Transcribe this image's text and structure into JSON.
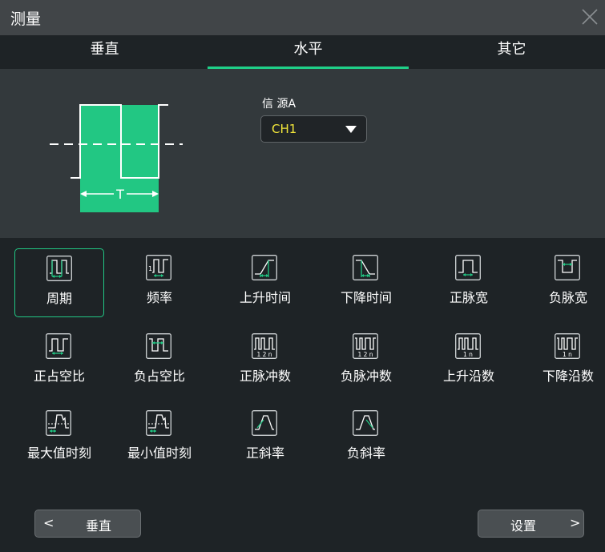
{
  "window": {
    "title": "测量"
  },
  "tabs": [
    {
      "label": "垂直",
      "active": false
    },
    {
      "label": "水平",
      "active": true
    },
    {
      "label": "其它",
      "active": false
    }
  ],
  "diagram": {
    "period_label": "T"
  },
  "source": {
    "label": "信 源A",
    "value": "CH1"
  },
  "items": [
    {
      "label": "周期",
      "icon": "period-icon",
      "selected": true
    },
    {
      "label": "频率",
      "icon": "frequency-icon"
    },
    {
      "label": "上升时间",
      "icon": "rise-time-icon"
    },
    {
      "label": "下降时间",
      "icon": "fall-time-icon"
    },
    {
      "label": "正脉宽",
      "icon": "positive-width-icon"
    },
    {
      "label": "负脉宽",
      "icon": "negative-width-icon"
    },
    {
      "label": "正占空比",
      "icon": "positive-duty-icon"
    },
    {
      "label": "负占空比",
      "icon": "negative-duty-icon"
    },
    {
      "label": "正脉冲数",
      "icon": "positive-pulse-count-icon",
      "icon_text": "1 2  n"
    },
    {
      "label": "负脉冲数",
      "icon": "negative-pulse-count-icon",
      "icon_text": "1 2  n"
    },
    {
      "label": "上升沿数",
      "icon": "rising-edge-count-icon",
      "icon_text": "1   n"
    },
    {
      "label": "下降沿数",
      "icon": "falling-edge-count-icon",
      "icon_text": "1   n"
    },
    {
      "label": "最大值时刻",
      "icon": "time-of-max-icon"
    },
    {
      "label": "最小值时刻",
      "icon": "time-of-min-icon"
    },
    {
      "label": "正斜率",
      "icon": "positive-slew-icon"
    },
    {
      "label": "负斜率",
      "icon": "negative-slew-icon"
    }
  ],
  "footer": {
    "prev": {
      "label": "垂直",
      "arrow": "<"
    },
    "next": {
      "label": "设置",
      "arrow": ">"
    }
  },
  "colors": {
    "accent": "#1fcf88",
    "source_value": "#f2e63a",
    "background": "#1e2326",
    "panel": "#33393c"
  }
}
